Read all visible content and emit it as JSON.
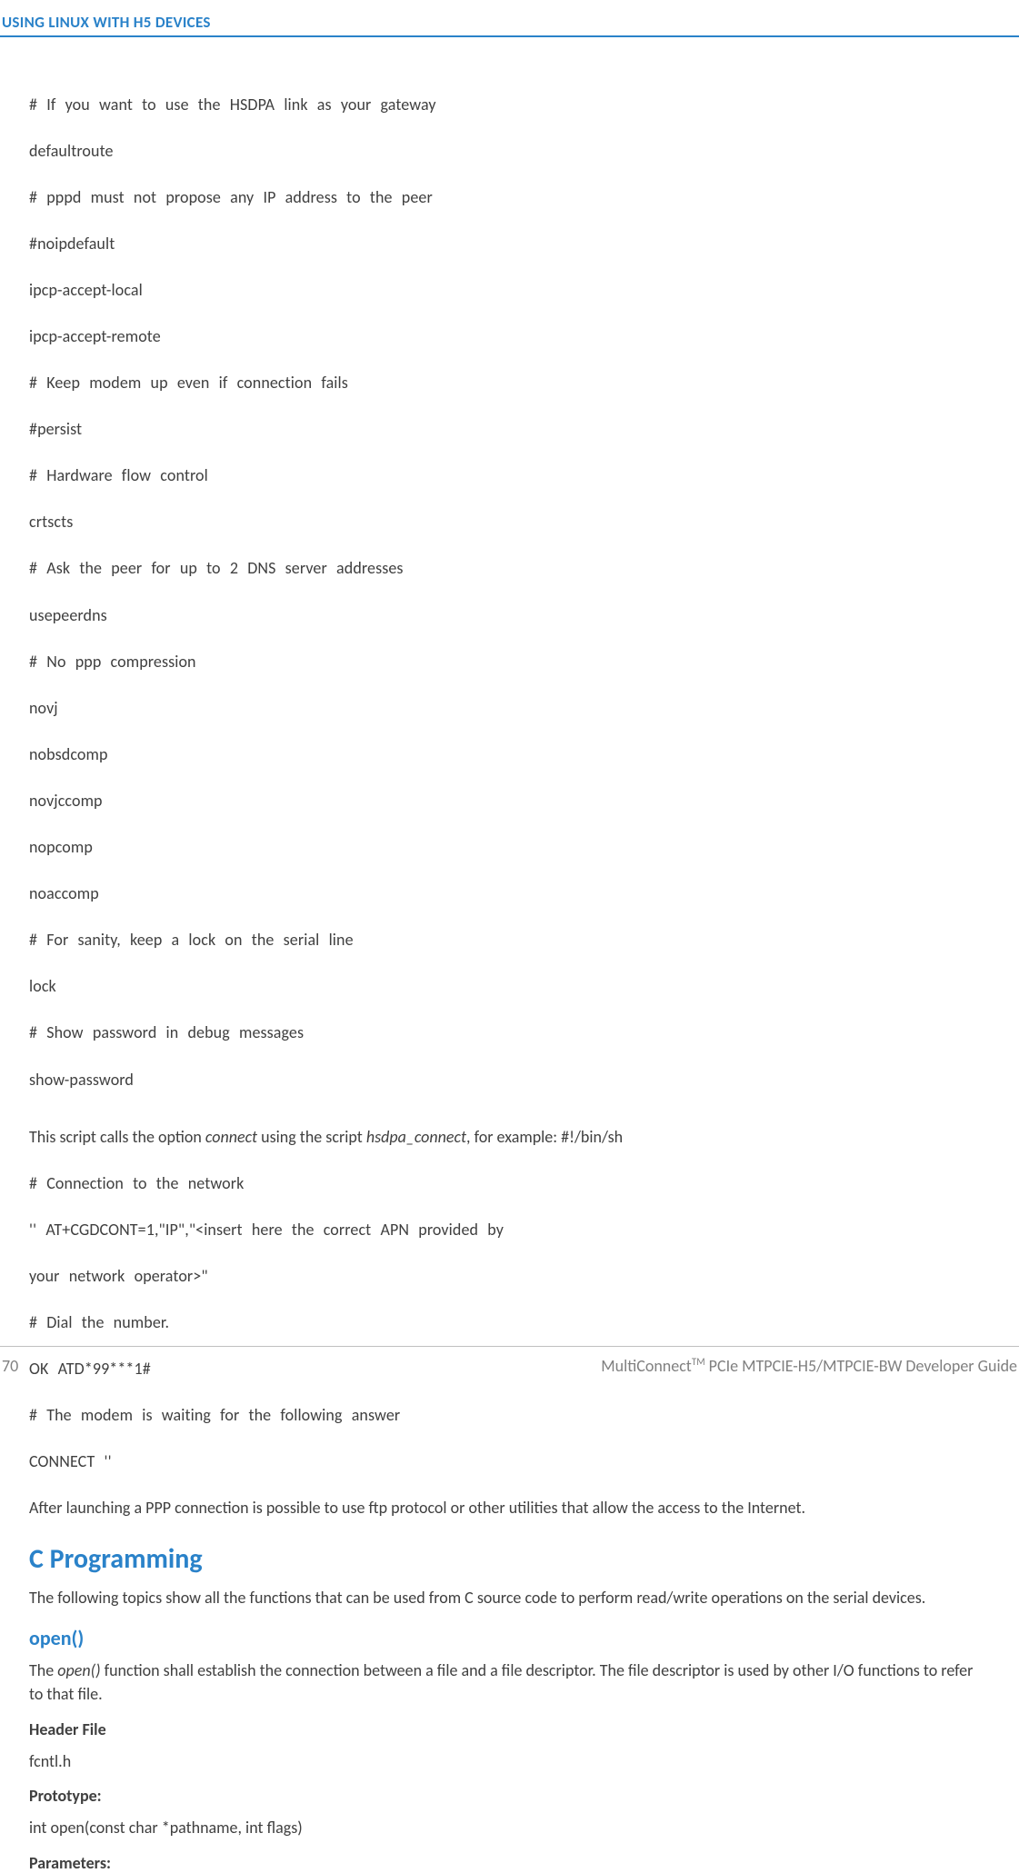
{
  "header": {
    "title": "USING LINUX WITH H5 DEVICES"
  },
  "code": {
    "l1": "# If you want to use the HSDPA link as your gateway",
    "l2": "defaultroute",
    "l3": "# pppd must not propose any IP address to the peer",
    "l4": "#noipdefault",
    "l5": "ipcp-accept-local",
    "l6": "ipcp-accept-remote",
    "l7": "# Keep modem up even if connection fails",
    "l8": "#persist",
    "l9": "# Hardware flow control",
    "l10": "crtscts",
    "l11": "# Ask the peer for up to 2 DNS server addresses",
    "l12": "usepeerdns",
    "l13": "# No ppp compression",
    "l14": "novj",
    "l15": "nobsdcomp",
    "l16": "novjccomp",
    "l17": "nopcomp",
    "l18": "noaccomp",
    "l19": "# For sanity, keep a lock on the serial line",
    "l20": "lock",
    "l21": "# Show password in debug messages",
    "l22": "show-password"
  },
  "para1": {
    "pre": "This script calls the option ",
    "connect": "connect",
    "mid": " using the script ",
    "hsdpa": "hsdpa_connect",
    "post": ", for example: #!/bin/sh"
  },
  "code2": {
    "l1": "# Connection to the network",
    "l2": "'' AT+CGDCONT=1,\"IP\",\"<insert here the correct APN provided by",
    "l3": "your network operator>\"",
    "l4": "# Dial the number.",
    "l5": "OK ATD*99***1#",
    "l6": "# The modem is waiting for the following answer",
    "l7": "CONNECT ''"
  },
  "para2": "After launching a PPP connection is possible to use ftp protocol or other utilities that allow the access to the Internet.",
  "section1": {
    "title": "C Programming",
    "body": "The following topics show all the functions that can be used from C source code to perform read/write operations on the serial devices."
  },
  "section2": {
    "title": "open()",
    "body_pre": "The ",
    "body_open": "open()",
    "body_post": " function shall establish the connection between a file and a file descriptor. The file descriptor is used by other I/O functions to refer to that file.",
    "header_file_label": "Header File",
    "header_file": "fcntl.h",
    "prototype_label": "Prototype:",
    "prototype": "int open(const char *pathname, int flags)",
    "parameters_label": "Parameters:"
  },
  "footer": {
    "page": "70",
    "right_pre": "MultiConnect",
    "right_tm": "TM",
    "right_post": " PCIe MTPCIE-H5/MTPCIE-BW Developer Guide"
  }
}
